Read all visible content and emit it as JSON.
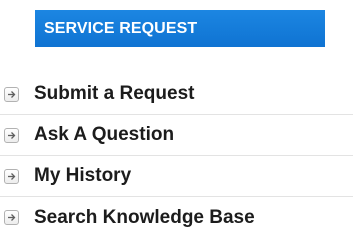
{
  "header": {
    "title": "SERVICE REQUEST"
  },
  "menu": {
    "items": [
      {
        "label": "Submit a Request",
        "icon": "arrow-right-icon"
      },
      {
        "label": "Ask A Question",
        "icon": "arrow-right-icon"
      },
      {
        "label": "My History",
        "icon": "arrow-right-icon"
      },
      {
        "label": "Search Knowledge Base",
        "icon": "arrow-right-icon"
      }
    ]
  },
  "colors": {
    "header_background": "#1580dc",
    "header_text": "#ffffff",
    "item_text": "#1c1c1c",
    "divider": "#e3e3e3",
    "icon_border": "#b2b2b2",
    "icon_arrow": "#5f5f5f"
  }
}
